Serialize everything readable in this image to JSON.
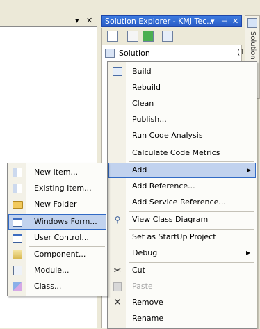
{
  "left_pane": {
    "dropdown_glyph": "▾",
    "close_glyph": "✕"
  },
  "solution_explorer": {
    "title": "Solution Explorer - KMJ Tec...",
    "pin_glyph": "▾",
    "autohide_glyph": "⊣",
    "close_glyph": "✕",
    "tree_root": "Solution",
    "count_fragment": "(1",
    "side_tab_label": "Solution E"
  },
  "main_menu": {
    "items": [
      {
        "label": "Build",
        "icon": "build-icon"
      },
      {
        "label": "Rebuild"
      },
      {
        "label": "Clean"
      },
      {
        "label": "Publish..."
      },
      {
        "label": "Run Code Analysis"
      },
      {
        "label": "Calculate Code Metrics"
      },
      {
        "label": "Add",
        "submenu": true,
        "selected": true
      },
      {
        "label": "Add Reference..."
      },
      {
        "label": "Add Service Reference..."
      },
      {
        "label": "View Class Diagram",
        "icon": "class-diagram-icon"
      },
      {
        "label": "Set as StartUp Project"
      },
      {
        "label": "Debug",
        "submenu": true
      },
      {
        "label": "Cut",
        "icon": "scissors-icon"
      },
      {
        "label": "Paste",
        "icon": "paste-icon",
        "disabled": true
      },
      {
        "label": "Remove",
        "icon": "remove-x-icon"
      },
      {
        "label": "Rename"
      }
    ]
  },
  "add_submenu": {
    "items": [
      {
        "label": "New Item...",
        "icon": "new-item-icon"
      },
      {
        "label": "Existing Item...",
        "icon": "existing-item-icon"
      },
      {
        "label": "New Folder",
        "icon": "folder-icon"
      },
      {
        "label": "Windows Form...",
        "icon": "windows-form-icon",
        "selected": true
      },
      {
        "label": "User Control...",
        "icon": "user-control-icon"
      },
      {
        "label": "Component...",
        "icon": "component-icon"
      },
      {
        "label": "Module...",
        "icon": "module-icon"
      },
      {
        "label": "Class...",
        "icon": "class-icon"
      }
    ]
  },
  "glyphs": {
    "submenu_arrow": "▶",
    "scissors": "✂",
    "remove": "✕"
  },
  "colors": {
    "selection_fill": "#C1D2EE",
    "selection_border": "#316AC5",
    "title_bar": "#2B5CC6",
    "disabled_text": "#A7A7A7"
  }
}
